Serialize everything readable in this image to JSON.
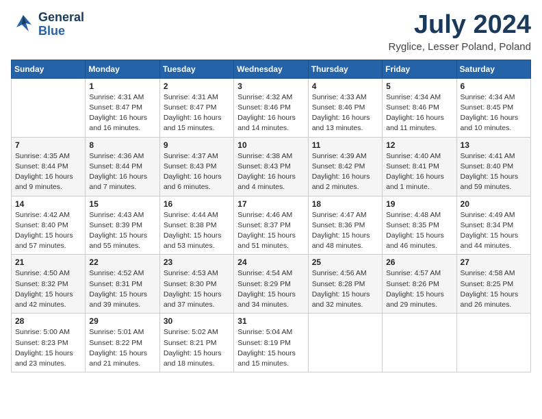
{
  "header": {
    "logo_line1": "General",
    "logo_line2": "Blue",
    "month_title": "July 2024",
    "location": "Ryglice, Lesser Poland, Poland"
  },
  "columns": [
    "Sunday",
    "Monday",
    "Tuesday",
    "Wednesday",
    "Thursday",
    "Friday",
    "Saturday"
  ],
  "weeks": [
    [
      {
        "day": "",
        "info": ""
      },
      {
        "day": "1",
        "info": "Sunrise: 4:31 AM\nSunset: 8:47 PM\nDaylight: 16 hours\nand 16 minutes."
      },
      {
        "day": "2",
        "info": "Sunrise: 4:31 AM\nSunset: 8:47 PM\nDaylight: 16 hours\nand 15 minutes."
      },
      {
        "day": "3",
        "info": "Sunrise: 4:32 AM\nSunset: 8:46 PM\nDaylight: 16 hours\nand 14 minutes."
      },
      {
        "day": "4",
        "info": "Sunrise: 4:33 AM\nSunset: 8:46 PM\nDaylight: 16 hours\nand 13 minutes."
      },
      {
        "day": "5",
        "info": "Sunrise: 4:34 AM\nSunset: 8:46 PM\nDaylight: 16 hours\nand 11 minutes."
      },
      {
        "day": "6",
        "info": "Sunrise: 4:34 AM\nSunset: 8:45 PM\nDaylight: 16 hours\nand 10 minutes."
      }
    ],
    [
      {
        "day": "7",
        "info": "Sunrise: 4:35 AM\nSunset: 8:44 PM\nDaylight: 16 hours\nand 9 minutes."
      },
      {
        "day": "8",
        "info": "Sunrise: 4:36 AM\nSunset: 8:44 PM\nDaylight: 16 hours\nand 7 minutes."
      },
      {
        "day": "9",
        "info": "Sunrise: 4:37 AM\nSunset: 8:43 PM\nDaylight: 16 hours\nand 6 minutes."
      },
      {
        "day": "10",
        "info": "Sunrise: 4:38 AM\nSunset: 8:43 PM\nDaylight: 16 hours\nand 4 minutes."
      },
      {
        "day": "11",
        "info": "Sunrise: 4:39 AM\nSunset: 8:42 PM\nDaylight: 16 hours\nand 2 minutes."
      },
      {
        "day": "12",
        "info": "Sunrise: 4:40 AM\nSunset: 8:41 PM\nDaylight: 16 hours\nand 1 minute."
      },
      {
        "day": "13",
        "info": "Sunrise: 4:41 AM\nSunset: 8:40 PM\nDaylight: 15 hours\nand 59 minutes."
      }
    ],
    [
      {
        "day": "14",
        "info": "Sunrise: 4:42 AM\nSunset: 8:40 PM\nDaylight: 15 hours\nand 57 minutes."
      },
      {
        "day": "15",
        "info": "Sunrise: 4:43 AM\nSunset: 8:39 PM\nDaylight: 15 hours\nand 55 minutes."
      },
      {
        "day": "16",
        "info": "Sunrise: 4:44 AM\nSunset: 8:38 PM\nDaylight: 15 hours\nand 53 minutes."
      },
      {
        "day": "17",
        "info": "Sunrise: 4:46 AM\nSunset: 8:37 PM\nDaylight: 15 hours\nand 51 minutes."
      },
      {
        "day": "18",
        "info": "Sunrise: 4:47 AM\nSunset: 8:36 PM\nDaylight: 15 hours\nand 48 minutes."
      },
      {
        "day": "19",
        "info": "Sunrise: 4:48 AM\nSunset: 8:35 PM\nDaylight: 15 hours\nand 46 minutes."
      },
      {
        "day": "20",
        "info": "Sunrise: 4:49 AM\nSunset: 8:34 PM\nDaylight: 15 hours\nand 44 minutes."
      }
    ],
    [
      {
        "day": "21",
        "info": "Sunrise: 4:50 AM\nSunset: 8:32 PM\nDaylight: 15 hours\nand 42 minutes."
      },
      {
        "day": "22",
        "info": "Sunrise: 4:52 AM\nSunset: 8:31 PM\nDaylight: 15 hours\nand 39 minutes."
      },
      {
        "day": "23",
        "info": "Sunrise: 4:53 AM\nSunset: 8:30 PM\nDaylight: 15 hours\nand 37 minutes."
      },
      {
        "day": "24",
        "info": "Sunrise: 4:54 AM\nSunset: 8:29 PM\nDaylight: 15 hours\nand 34 minutes."
      },
      {
        "day": "25",
        "info": "Sunrise: 4:56 AM\nSunset: 8:28 PM\nDaylight: 15 hours\nand 32 minutes."
      },
      {
        "day": "26",
        "info": "Sunrise: 4:57 AM\nSunset: 8:26 PM\nDaylight: 15 hours\nand 29 minutes."
      },
      {
        "day": "27",
        "info": "Sunrise: 4:58 AM\nSunset: 8:25 PM\nDaylight: 15 hours\nand 26 minutes."
      }
    ],
    [
      {
        "day": "28",
        "info": "Sunrise: 5:00 AM\nSunset: 8:23 PM\nDaylight: 15 hours\nand 23 minutes."
      },
      {
        "day": "29",
        "info": "Sunrise: 5:01 AM\nSunset: 8:22 PM\nDaylight: 15 hours\nand 21 minutes."
      },
      {
        "day": "30",
        "info": "Sunrise: 5:02 AM\nSunset: 8:21 PM\nDaylight: 15 hours\nand 18 minutes."
      },
      {
        "day": "31",
        "info": "Sunrise: 5:04 AM\nSunset: 8:19 PM\nDaylight: 15 hours\nand 15 minutes."
      },
      {
        "day": "",
        "info": ""
      },
      {
        "day": "",
        "info": ""
      },
      {
        "day": "",
        "info": ""
      }
    ]
  ]
}
